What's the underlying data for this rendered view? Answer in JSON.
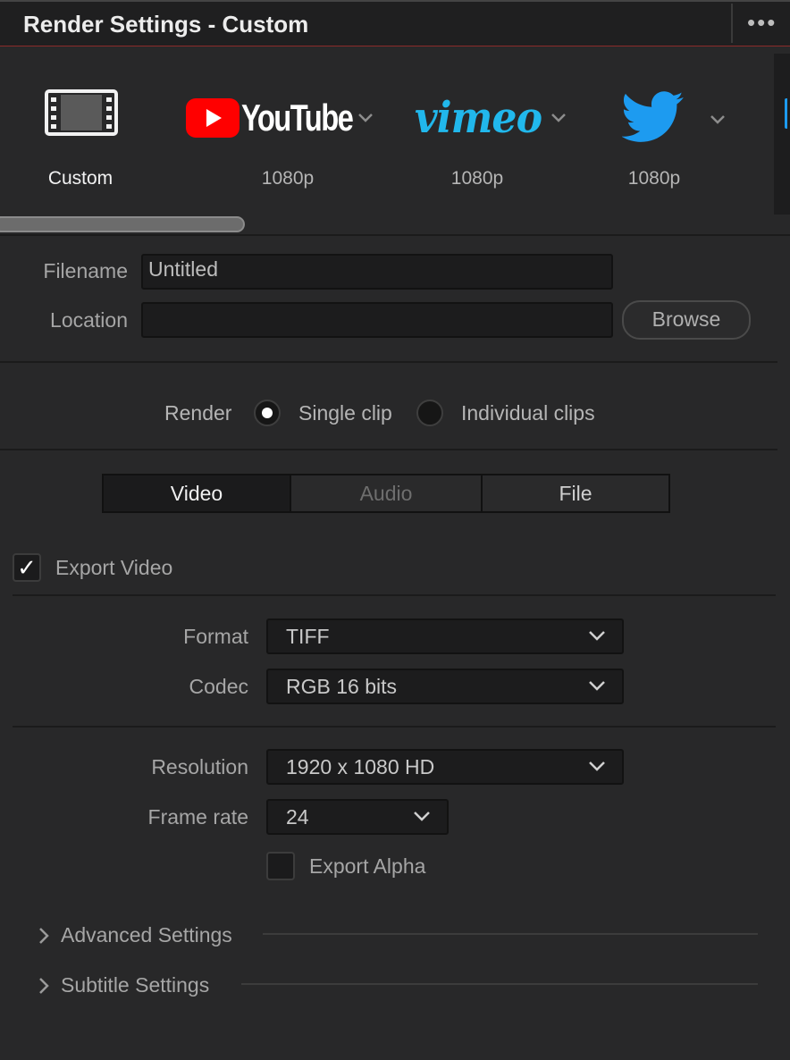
{
  "window": {
    "title": "Render Settings - Custom",
    "menu_icon": "more-horizontal-icon"
  },
  "presets": [
    {
      "name": "Custom",
      "icon": "film-icon",
      "label": "Custom",
      "selected": true
    },
    {
      "name": "YouTube",
      "icon": "youtube-logo",
      "logo_text": "YouTube",
      "label": "1080p"
    },
    {
      "name": "Vimeo",
      "icon": "vimeo-logo",
      "logo_text": "vimeo",
      "label": "1080p"
    },
    {
      "name": "Twitter",
      "icon": "twitter-bird-logo",
      "label": "1080p"
    }
  ],
  "file": {
    "filename_label": "Filename",
    "filename_value": "Untitled",
    "location_label": "Location",
    "location_value": "",
    "browse_label": "Browse"
  },
  "render_mode": {
    "label": "Render",
    "options": [
      "Single clip",
      "Individual clips"
    ],
    "selected": "Single clip"
  },
  "tabs": [
    {
      "label": "Video",
      "state": "active"
    },
    {
      "label": "Audio",
      "state": "disabled"
    },
    {
      "label": "File",
      "state": "normal"
    }
  ],
  "video": {
    "export_video_label": "Export Video",
    "export_video_checked": true,
    "format_label": "Format",
    "format_value": "TIFF",
    "codec_label": "Codec",
    "codec_value": "RGB 16 bits",
    "resolution_label": "Resolution",
    "resolution_value": "1920 x 1080 HD",
    "framerate_label": "Frame rate",
    "framerate_value": "24",
    "export_alpha_label": "Export Alpha",
    "export_alpha_checked": false
  },
  "sections": {
    "advanced": "Advanced Settings",
    "subtitle": "Subtitle Settings"
  },
  "colors": {
    "youtube_red": "#ff0000",
    "vimeo_blue": "#21b8ec",
    "twitter_blue": "#1d9bf0",
    "title_separator": "#8c2a2a"
  }
}
